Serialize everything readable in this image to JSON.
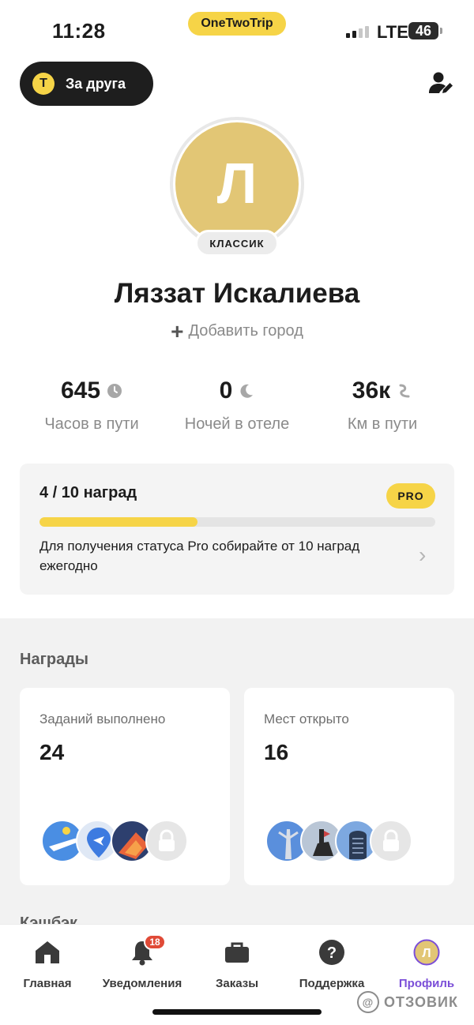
{
  "status_bar": {
    "time": "11:28",
    "app_name": "OneTwoTrip",
    "network": "LTE",
    "battery": "46"
  },
  "header": {
    "friend_button_label": "За друга",
    "friend_button_icon_letter": "T",
    "edit_icon": "person-edit-icon"
  },
  "profile": {
    "avatar_letter": "Л",
    "tier": "КЛАССИК",
    "name": "Ляззат Искалиева",
    "add_city_label": "Добавить город",
    "avatar_color": "#e2c675"
  },
  "stats": [
    {
      "value": "645",
      "label": "Часов в пути",
      "icon": "clock-icon"
    },
    {
      "value": "0",
      "label": "Ночей в отеле",
      "icon": "moon-icon"
    },
    {
      "value": "36к",
      "label": "Км в пути",
      "icon": "route-icon"
    }
  ],
  "rewards_progress": {
    "count_label": "4 / 10 наград",
    "badge": "PRO",
    "progress_fraction": 0.4,
    "description": "Для получения статуса Pro собирайте от 10 наград ежегодно"
  },
  "awards": {
    "section_title": "Награды",
    "cards": [
      {
        "label": "Заданий выполнено",
        "value": "24"
      },
      {
        "label": "Мест открыто",
        "value": "16"
      }
    ]
  },
  "next_section_title": "Кэшбэк",
  "nav": {
    "items": [
      {
        "label": "Главная",
        "icon": "home-icon"
      },
      {
        "label": "Уведомления",
        "icon": "bell-icon",
        "badge": "18"
      },
      {
        "label": "Заказы",
        "icon": "briefcase-icon"
      },
      {
        "label": "Поддержка",
        "icon": "help-icon"
      },
      {
        "label": "Профиль",
        "icon": "profile-icon",
        "avatar_letter": "Л"
      }
    ],
    "active_index": 4
  },
  "watermark": "ОТЗОВИК",
  "colors": {
    "accent": "#f6d447",
    "active_nav": "#7b4ed8",
    "badge_red": "#e04a37"
  }
}
